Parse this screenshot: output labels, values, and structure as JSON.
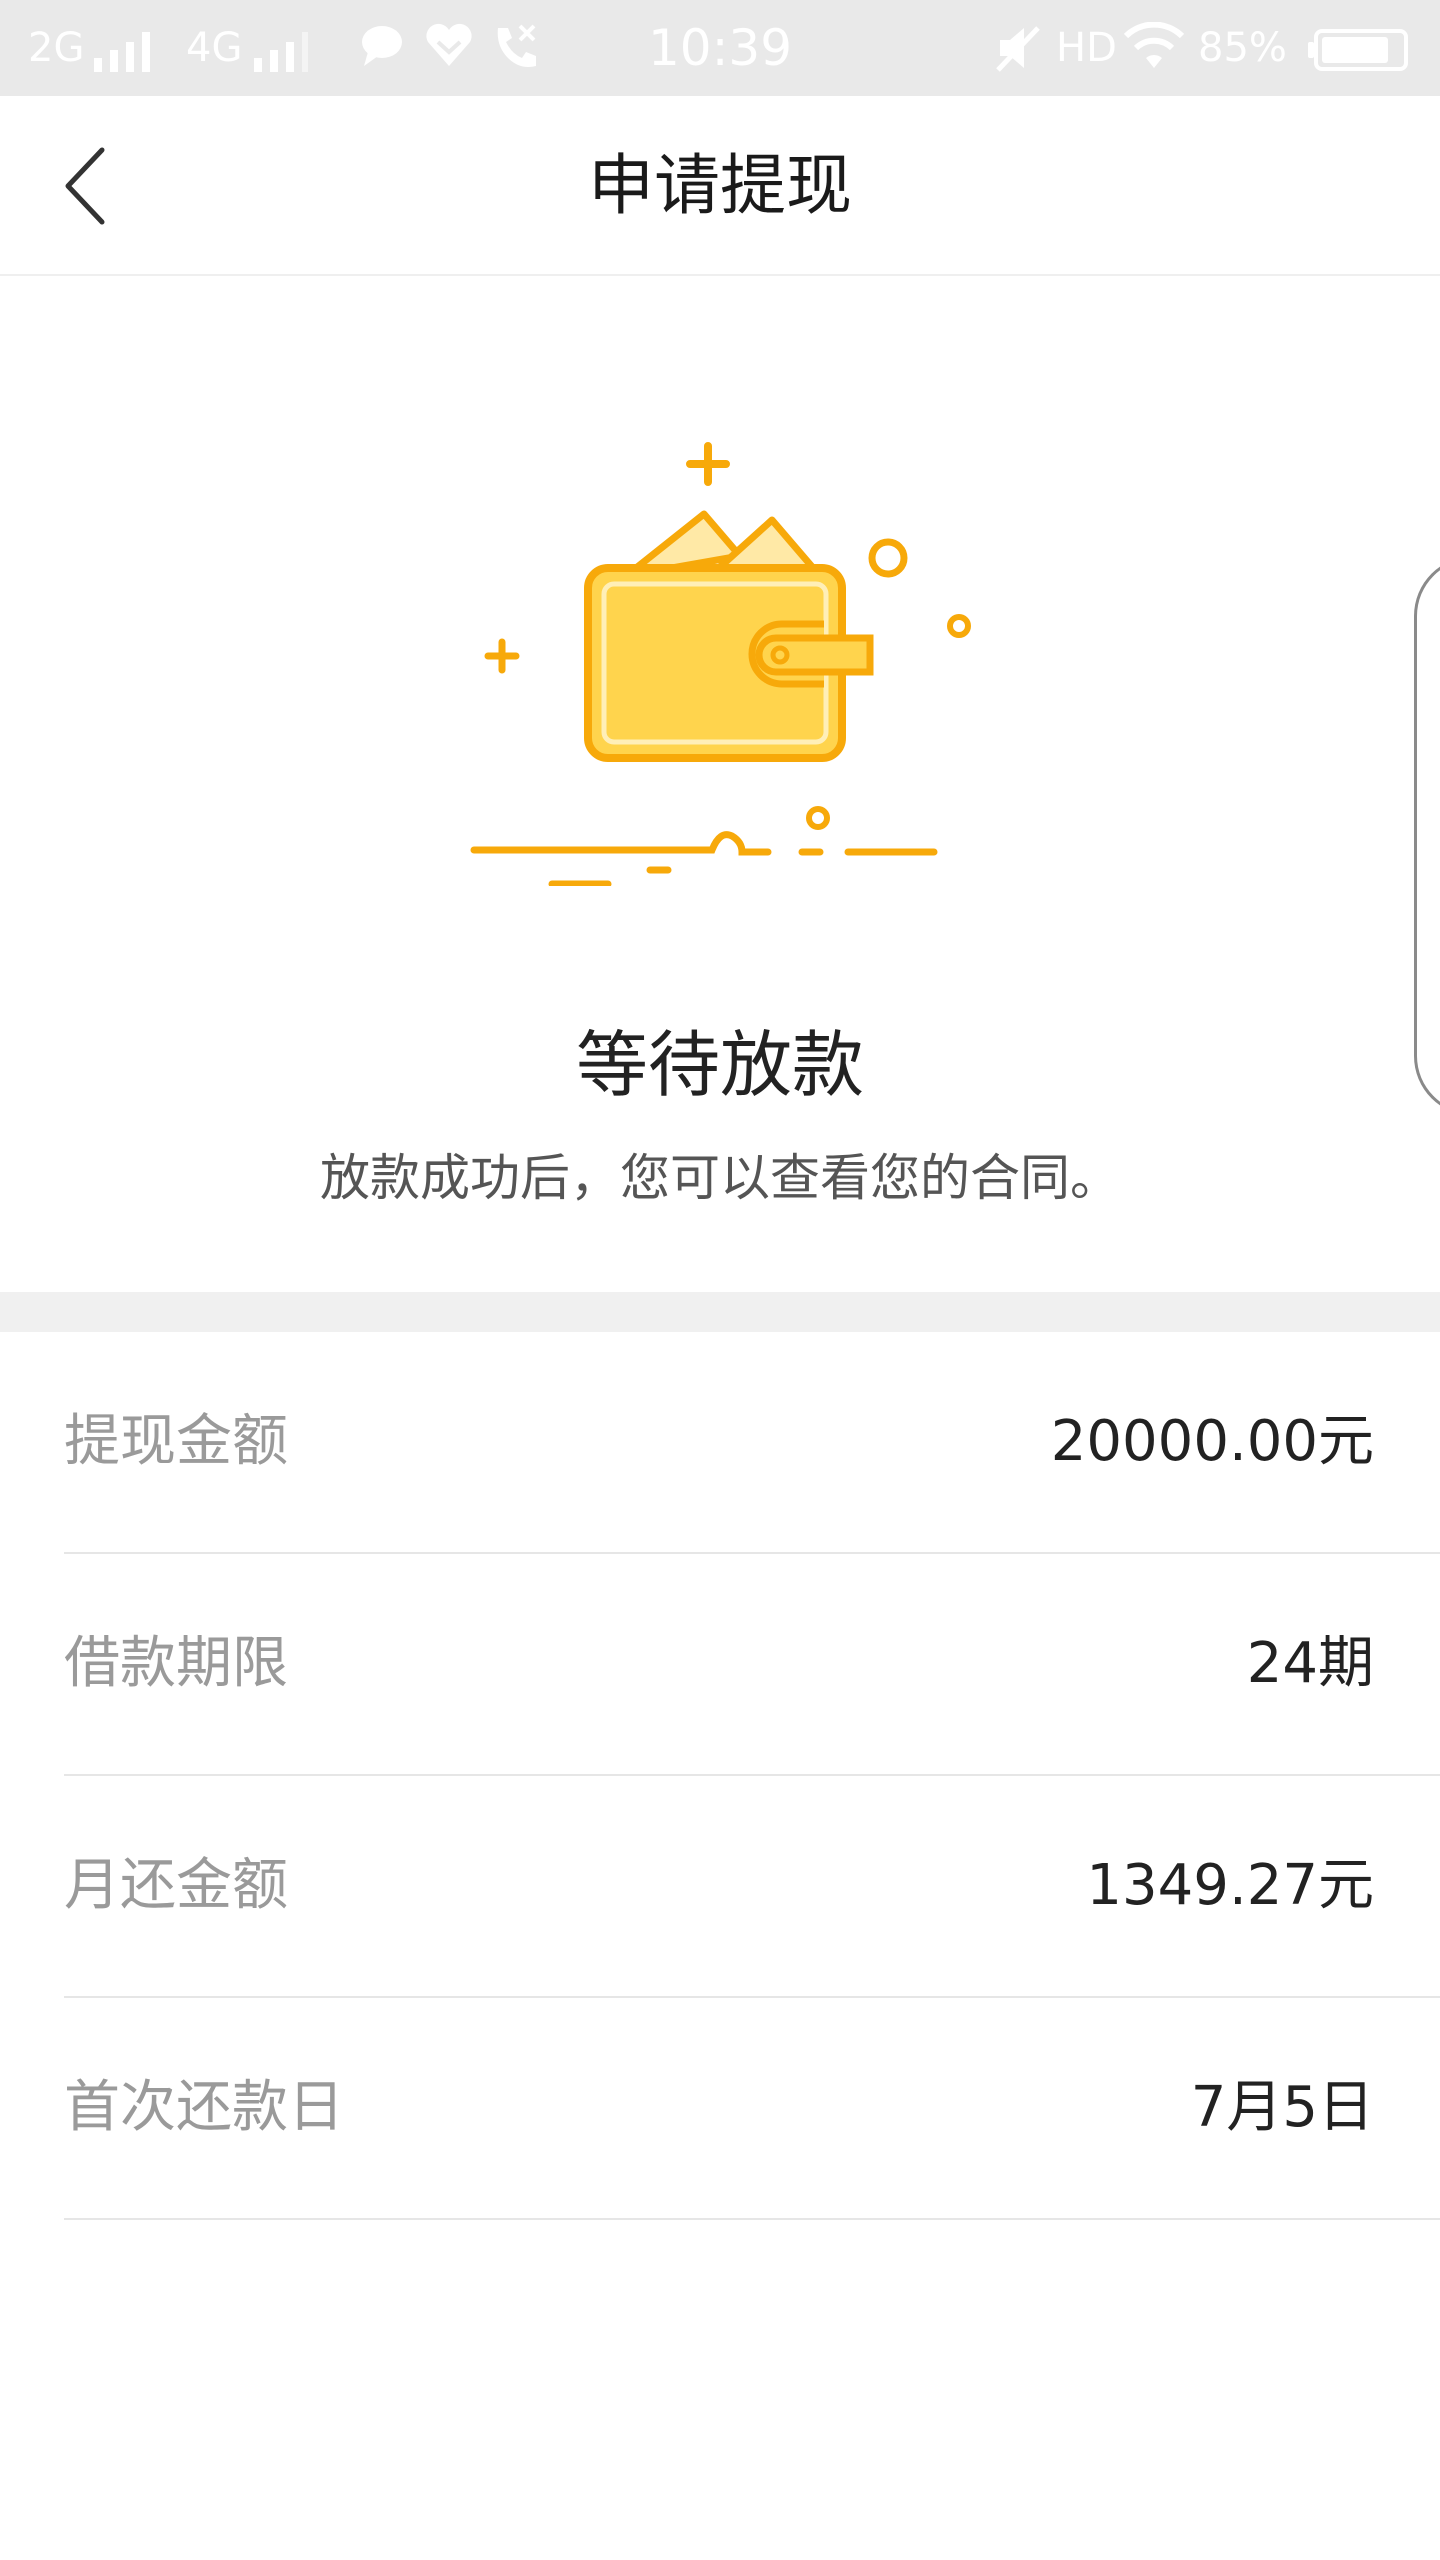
{
  "status_bar": {
    "network_1": "2G",
    "network_2": "4G",
    "time": "10:39",
    "hd": "HD",
    "battery_percent": "85%",
    "icons": [
      "signal-icon",
      "message-icon",
      "heart-icon",
      "call-icon",
      "mute-icon",
      "wifi-icon",
      "battery-icon"
    ],
    "battery_level": 0.85
  },
  "nav": {
    "title": "申请提现",
    "back_icon": "chevron-left-icon"
  },
  "hero": {
    "illustration": "wallet-icon",
    "title": "等待放款",
    "subtitle": "放款成功后，您可以查看您的合同。",
    "colors": {
      "wallet_fill": "#FFD44D",
      "wallet_stroke": "#F7A90A"
    }
  },
  "details": {
    "rows": [
      {
        "label": "提现金额",
        "value": "20000.00元"
      },
      {
        "label": "借款期限",
        "value": "24期"
      },
      {
        "label": "月还金额",
        "value": "1349.27元"
      },
      {
        "label": "首次还款日",
        "value": "7月5日"
      }
    ]
  }
}
